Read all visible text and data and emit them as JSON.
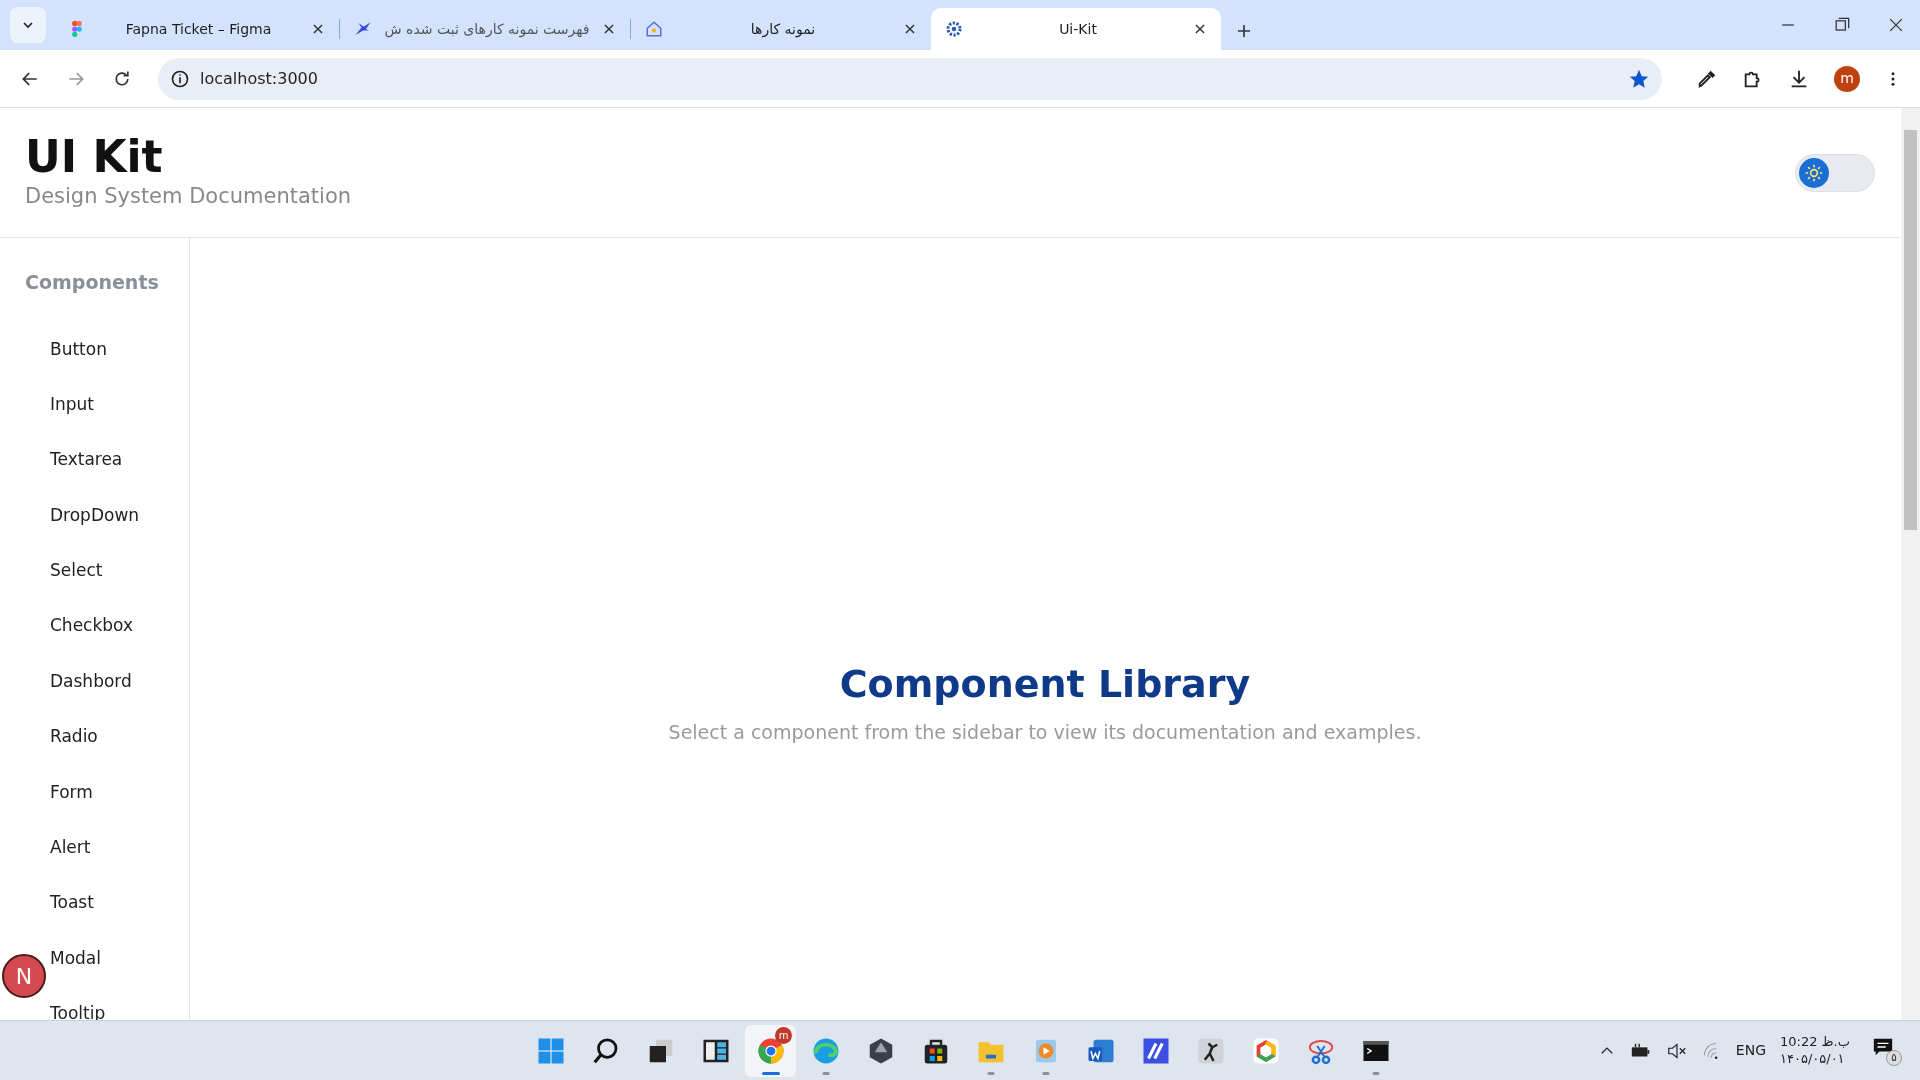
{
  "browser": {
    "tabs": [
      {
        "title": "Fapna Ticket – Figma",
        "selected": false,
        "faded": false
      },
      {
        "title": "فهرست نمونه کارهای ثبت شده ش",
        "selected": false,
        "faded": true
      },
      {
        "title": "نمونه کارها",
        "selected": false,
        "faded": false
      },
      {
        "title": "Ui-Kit",
        "selected": true,
        "faded": false
      }
    ],
    "address": "localhost:3000",
    "bookmarked": true,
    "profile": "m"
  },
  "header": {
    "title": "UI Kit",
    "subtitle": "Design System Documentation",
    "theme_toggle": {
      "dark": false
    }
  },
  "sidebar": {
    "heading": "Components",
    "items": [
      {
        "label": "Button"
      },
      {
        "label": "Input"
      },
      {
        "label": "Textarea"
      },
      {
        "label": "DropDown"
      },
      {
        "label": "Select"
      },
      {
        "label": "Checkbox"
      },
      {
        "label": "Dashbord"
      },
      {
        "label": "Radio"
      },
      {
        "label": "Form"
      },
      {
        "label": "Alert"
      },
      {
        "label": "Toast"
      },
      {
        "label": "Modal"
      },
      {
        "label": "Tooltip"
      }
    ]
  },
  "main": {
    "title": "Component Library",
    "text": "Select a component from the sidebar to view its documentation and examples."
  },
  "dev_badge": "N",
  "taskbar": {
    "apps": [
      {
        "kind": "start",
        "running": false,
        "active": false
      },
      {
        "kind": "search",
        "running": false,
        "active": false
      },
      {
        "kind": "taskview",
        "running": false,
        "active": false
      },
      {
        "kind": "widgets",
        "running": false,
        "active": false
      },
      {
        "kind": "chrome",
        "running": true,
        "active": true,
        "badge": "m"
      },
      {
        "kind": "edge",
        "running": true,
        "active": false
      },
      {
        "kind": "gem",
        "running": false,
        "active": false
      },
      {
        "kind": "store",
        "running": false,
        "active": false
      },
      {
        "kind": "folder",
        "running": true,
        "active": false
      },
      {
        "kind": "player",
        "running": true,
        "active": false
      },
      {
        "kind": "word",
        "running": false,
        "active": false
      },
      {
        "kind": "tile",
        "running": false,
        "active": false
      },
      {
        "kind": "figure",
        "running": false,
        "active": false
      },
      {
        "kind": "hexagon",
        "running": false,
        "active": false
      },
      {
        "kind": "scissors",
        "running": false,
        "active": false
      },
      {
        "kind": "terminal",
        "running": true,
        "active": false
      }
    ],
    "language": "ENG",
    "time": "10:22 ب.ظ",
    "date": "۱۴۰۵/۰۵/۰۱",
    "notifications": "۵"
  }
}
